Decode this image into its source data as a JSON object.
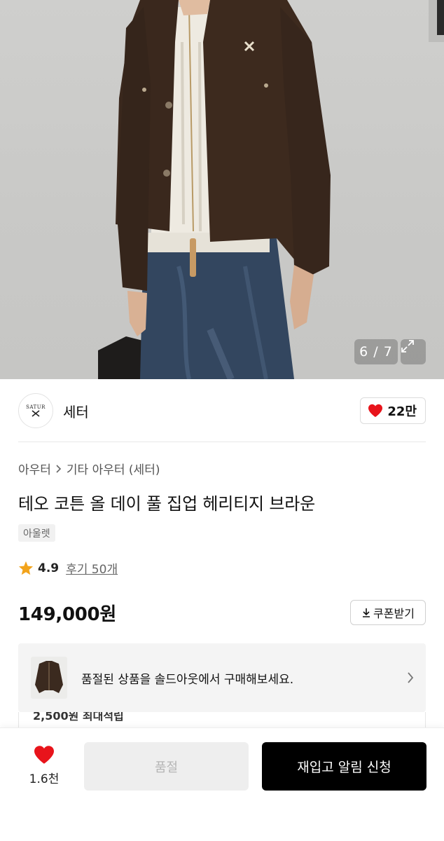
{
  "gallery": {
    "counter": "6 / 7",
    "icons": {
      "expand": "expand-arrows-icon"
    }
  },
  "brand": {
    "logo_text": "SATUR",
    "name": "세터",
    "like_count": "22만",
    "icons": {
      "like": "heart-icon"
    }
  },
  "product": {
    "breadcrumb": [
      "아우터",
      "기타 아우터 (세터)"
    ],
    "title": "테오 코튼 올 데이 풀 집업 헤리티지 브라운",
    "tag": "아울렛",
    "rating": "4.9",
    "review_link": "후기 50개",
    "price": "149,000원",
    "coupon_label": "쿠폰받기"
  },
  "soldout_banner": {
    "text": "품절된 상품을 솔드아웃에서 구매해보세요.",
    "points_text": "2,500원 최대적립"
  },
  "bottom_bar": {
    "like_count": "1.6천",
    "soldout_label": "품절",
    "restock_label": "재입고 알림 신청"
  },
  "colors": {
    "accent_red": "#e8141b",
    "star": "#f2a31b",
    "primary_black": "#000000"
  }
}
